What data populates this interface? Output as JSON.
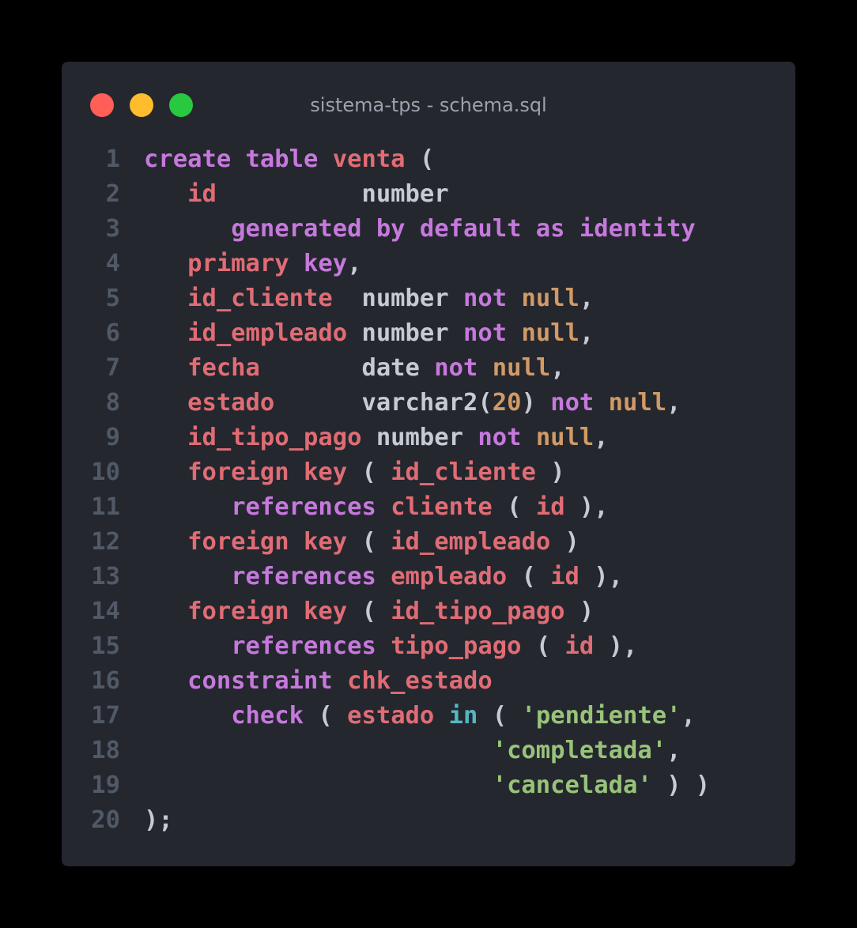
{
  "window": {
    "title": "sistema-tps - schema.sql"
  },
  "traffic_lights": {
    "close_color": "#ff5f57",
    "minimize_color": "#febc2e",
    "maximize_color": "#28c840"
  },
  "theme": {
    "background": "#24272e",
    "keyword_color": "#c678dd",
    "identifier_color": "#e06c75",
    "literal_color": "#d19a66",
    "string_color": "#98c379",
    "operator_color": "#56b6c2",
    "text_color": "#c5cad3",
    "line_number_color": "#515967"
  },
  "code": {
    "lines": [
      {
        "n": "1",
        "tokens": [
          {
            "t": "create table ",
            "c": "kw"
          },
          {
            "t": "venta",
            "c": "red"
          },
          {
            "t": " (",
            "c": "plain"
          }
        ]
      },
      {
        "n": "2",
        "tokens": [
          {
            "t": "   ",
            "c": "plain"
          },
          {
            "t": "id",
            "c": "red"
          },
          {
            "t": "          number",
            "c": "plain"
          }
        ]
      },
      {
        "n": "3",
        "tokens": [
          {
            "t": "      ",
            "c": "plain"
          },
          {
            "t": "generated by default as identity",
            "c": "kw"
          }
        ]
      },
      {
        "n": "4",
        "tokens": [
          {
            "t": "   ",
            "c": "plain"
          },
          {
            "t": "primary ",
            "c": "red"
          },
          {
            "t": "key",
            "c": "kw"
          },
          {
            "t": ",",
            "c": "plain"
          }
        ]
      },
      {
        "n": "5",
        "tokens": [
          {
            "t": "   ",
            "c": "plain"
          },
          {
            "t": "id_cliente",
            "c": "red"
          },
          {
            "t": "  number ",
            "c": "plain"
          },
          {
            "t": "not ",
            "c": "kw"
          },
          {
            "t": "null",
            "c": "num"
          },
          {
            "t": ",",
            "c": "plain"
          }
        ]
      },
      {
        "n": "6",
        "tokens": [
          {
            "t": "   ",
            "c": "plain"
          },
          {
            "t": "id_empleado",
            "c": "red"
          },
          {
            "t": " number ",
            "c": "plain"
          },
          {
            "t": "not ",
            "c": "kw"
          },
          {
            "t": "null",
            "c": "num"
          },
          {
            "t": ",",
            "c": "plain"
          }
        ]
      },
      {
        "n": "7",
        "tokens": [
          {
            "t": "   ",
            "c": "plain"
          },
          {
            "t": "fecha",
            "c": "red"
          },
          {
            "t": "       date ",
            "c": "plain"
          },
          {
            "t": "not ",
            "c": "kw"
          },
          {
            "t": "null",
            "c": "num"
          },
          {
            "t": ",",
            "c": "plain"
          }
        ]
      },
      {
        "n": "8",
        "tokens": [
          {
            "t": "   ",
            "c": "plain"
          },
          {
            "t": "estado",
            "c": "red"
          },
          {
            "t": "      varchar2(",
            "c": "plain"
          },
          {
            "t": "20",
            "c": "num"
          },
          {
            "t": ") ",
            "c": "plain"
          },
          {
            "t": "not ",
            "c": "kw"
          },
          {
            "t": "null",
            "c": "num"
          },
          {
            "t": ",",
            "c": "plain"
          }
        ]
      },
      {
        "n": "9",
        "tokens": [
          {
            "t": "   ",
            "c": "plain"
          },
          {
            "t": "id_tipo_pago",
            "c": "red"
          },
          {
            "t": " number ",
            "c": "plain"
          },
          {
            "t": "not ",
            "c": "kw"
          },
          {
            "t": "null",
            "c": "num"
          },
          {
            "t": ",",
            "c": "plain"
          }
        ]
      },
      {
        "n": "10",
        "tokens": [
          {
            "t": "   ",
            "c": "plain"
          },
          {
            "t": "foreign key",
            "c": "red"
          },
          {
            "t": " ( ",
            "c": "plain"
          },
          {
            "t": "id_cliente",
            "c": "red"
          },
          {
            "t": " )",
            "c": "plain"
          }
        ]
      },
      {
        "n": "11",
        "tokens": [
          {
            "t": "      ",
            "c": "plain"
          },
          {
            "t": "references ",
            "c": "kw"
          },
          {
            "t": "cliente",
            "c": "red"
          },
          {
            "t": " ( ",
            "c": "plain"
          },
          {
            "t": "id",
            "c": "red"
          },
          {
            "t": " ),",
            "c": "plain"
          }
        ]
      },
      {
        "n": "12",
        "tokens": [
          {
            "t": "   ",
            "c": "plain"
          },
          {
            "t": "foreign key",
            "c": "red"
          },
          {
            "t": " ( ",
            "c": "plain"
          },
          {
            "t": "id_empleado",
            "c": "red"
          },
          {
            "t": " )",
            "c": "plain"
          }
        ]
      },
      {
        "n": "13",
        "tokens": [
          {
            "t": "      ",
            "c": "plain"
          },
          {
            "t": "references ",
            "c": "kw"
          },
          {
            "t": "empleado",
            "c": "red"
          },
          {
            "t": " ( ",
            "c": "plain"
          },
          {
            "t": "id",
            "c": "red"
          },
          {
            "t": " ),",
            "c": "plain"
          }
        ]
      },
      {
        "n": "14",
        "tokens": [
          {
            "t": "   ",
            "c": "plain"
          },
          {
            "t": "foreign key",
            "c": "red"
          },
          {
            "t": " ( ",
            "c": "plain"
          },
          {
            "t": "id_tipo_pago",
            "c": "red"
          },
          {
            "t": " )",
            "c": "plain"
          }
        ]
      },
      {
        "n": "15",
        "tokens": [
          {
            "t": "      ",
            "c": "plain"
          },
          {
            "t": "references ",
            "c": "kw"
          },
          {
            "t": "tipo_pago",
            "c": "red"
          },
          {
            "t": " ( ",
            "c": "plain"
          },
          {
            "t": "id",
            "c": "red"
          },
          {
            "t": " ),",
            "c": "plain"
          }
        ]
      },
      {
        "n": "16",
        "tokens": [
          {
            "t": "   ",
            "c": "plain"
          },
          {
            "t": "constraint ",
            "c": "kw"
          },
          {
            "t": "chk_estado",
            "c": "red"
          }
        ]
      },
      {
        "n": "17",
        "tokens": [
          {
            "t": "      ",
            "c": "plain"
          },
          {
            "t": "check",
            "c": "kw"
          },
          {
            "t": " ( ",
            "c": "plain"
          },
          {
            "t": "estado",
            "c": "red"
          },
          {
            "t": " ",
            "c": "plain"
          },
          {
            "t": "in",
            "c": "cyan"
          },
          {
            "t": " ( ",
            "c": "plain"
          },
          {
            "t": "'pendiente'",
            "c": "str"
          },
          {
            "t": ",",
            "c": "plain"
          }
        ]
      },
      {
        "n": "18",
        "tokens": [
          {
            "t": "                        ",
            "c": "plain"
          },
          {
            "t": "'completada'",
            "c": "str"
          },
          {
            "t": ",",
            "c": "plain"
          }
        ]
      },
      {
        "n": "19",
        "tokens": [
          {
            "t": "                        ",
            "c": "plain"
          },
          {
            "t": "'cancelada'",
            "c": "str"
          },
          {
            "t": " ) )",
            "c": "plain"
          }
        ]
      },
      {
        "n": "20",
        "tokens": [
          {
            "t": ");",
            "c": "plain"
          }
        ]
      }
    ]
  }
}
